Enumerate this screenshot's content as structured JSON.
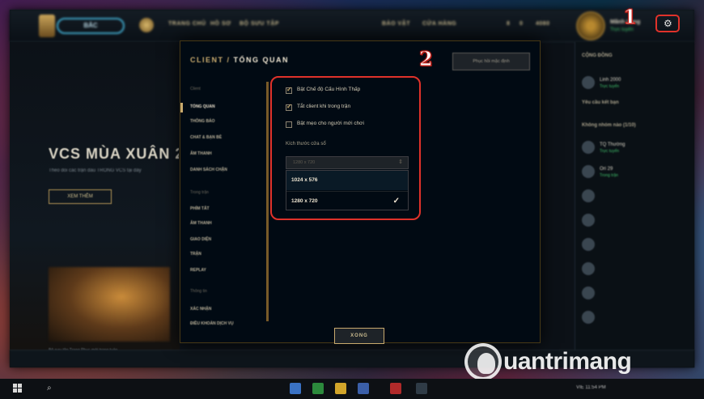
{
  "top_nav": {
    "play_label": "BẮC",
    "items": [
      "TRANG CHỦ",
      "HỒ SƠ",
      "BỘ SƯU TẬP",
      "BẢO VẬT",
      "CỬA HÀNG",
      "8",
      "0",
      "4080"
    ],
    "profile_name": "Mãnh Long",
    "profile_status": "Trực tuyến"
  },
  "background": {
    "headline": "VCS MÙA XUÂN 2",
    "subtext": "Theo dõi các trận đấu TRONG VCS tại đây",
    "cta": "XEM THÊM",
    "caption": "Bộ sưu tập Trang Phục mới trong tuần"
  },
  "social": {
    "header": "CỘNG ĐỒNG",
    "section": "Yêu cầu kết bạn",
    "group": "Không nhóm nào (1/10)",
    "friends": [
      {
        "name": "Linh 2000",
        "status": "Trực tuyến"
      },
      {
        "name": "TQ Thường",
        "status": "Trực tuyến"
      },
      {
        "name": "Ori 29",
        "status": "Trong trận"
      }
    ]
  },
  "callouts": {
    "one": "1",
    "two": "2"
  },
  "dialog": {
    "title_prefix": "CLIENT /",
    "title_main": "TỔNG QUAN",
    "report_button": "Phục hồi mặc định",
    "sidebar": {
      "group_client": "Client",
      "group_ingame": "Trong trận",
      "group_about": "Thông tin",
      "client_items": [
        "TỔNG QUAN",
        "THÔNG BÁO",
        "CHAT & BẠN BÈ",
        "ÂM THANH",
        "DANH SÁCH CHẶN"
      ],
      "ingame_items": [
        "PHÍM TẮT",
        "ÂM THANH",
        "GIAO DIỆN",
        "TRẬN",
        "REPLAY"
      ],
      "about_items": [
        "XÁC NHẬN",
        "ĐIỀU KHOẢN DỊCH VỤ"
      ]
    },
    "checkboxes": [
      {
        "label": "Bật Chế độ Cấu Hình Thấp",
        "checked": true
      },
      {
        "label": "Tắt client khi trong trận",
        "checked": true
      },
      {
        "label": "Bật mẹo cho người mới chơi",
        "checked": false
      }
    ],
    "window_size_label": "Kích thước cửa sổ",
    "window_size_selected": "1280 x 720",
    "window_size_options": [
      "1024 x 576",
      "1280 x 720"
    ],
    "done_button": "XONG"
  },
  "watermark": {
    "text": "uantrimang"
  },
  "taskbar": {
    "tray": "VIE 11:54 PM"
  }
}
